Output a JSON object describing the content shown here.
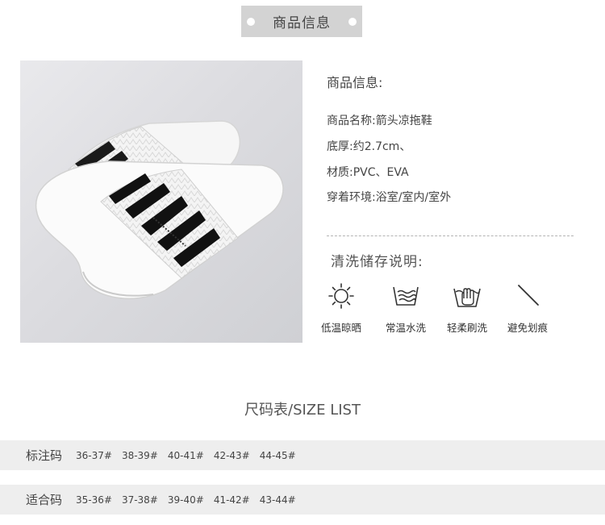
{
  "header": {
    "title": "商品信息"
  },
  "info": {
    "heading": "商品信息:",
    "specs": [
      {
        "label": "商品名称:",
        "value": "箭头凉拖鞋"
      },
      {
        "label": "底厚:",
        "value": "约2.7cm、"
      },
      {
        "label": "材质:",
        "value": "PVC、EVA"
      },
      {
        "label": "穿着环境:",
        "value": "浴室/室内/室外"
      }
    ]
  },
  "care": {
    "heading": "清洗储存说明:",
    "items": [
      {
        "icon": "sun-icon",
        "label": "低温晾晒"
      },
      {
        "icon": "water-wash-icon",
        "label": "常温水洗"
      },
      {
        "icon": "hand-wash-icon",
        "label": "轻柔刷洗"
      },
      {
        "icon": "no-scratch-icon",
        "label": "避免划痕"
      }
    ]
  },
  "size_table": {
    "title": "尺码表/SIZE LIST",
    "rows": [
      {
        "label": "标注码",
        "values": [
          "36-37#",
          "38-39#",
          "40-41#",
          "42-43#",
          "44-45#"
        ]
      },
      {
        "label": "适合码",
        "values": [
          "35-36#",
          "37-38#",
          "39-40#",
          "41-42#",
          "43-44#"
        ]
      }
    ]
  }
}
